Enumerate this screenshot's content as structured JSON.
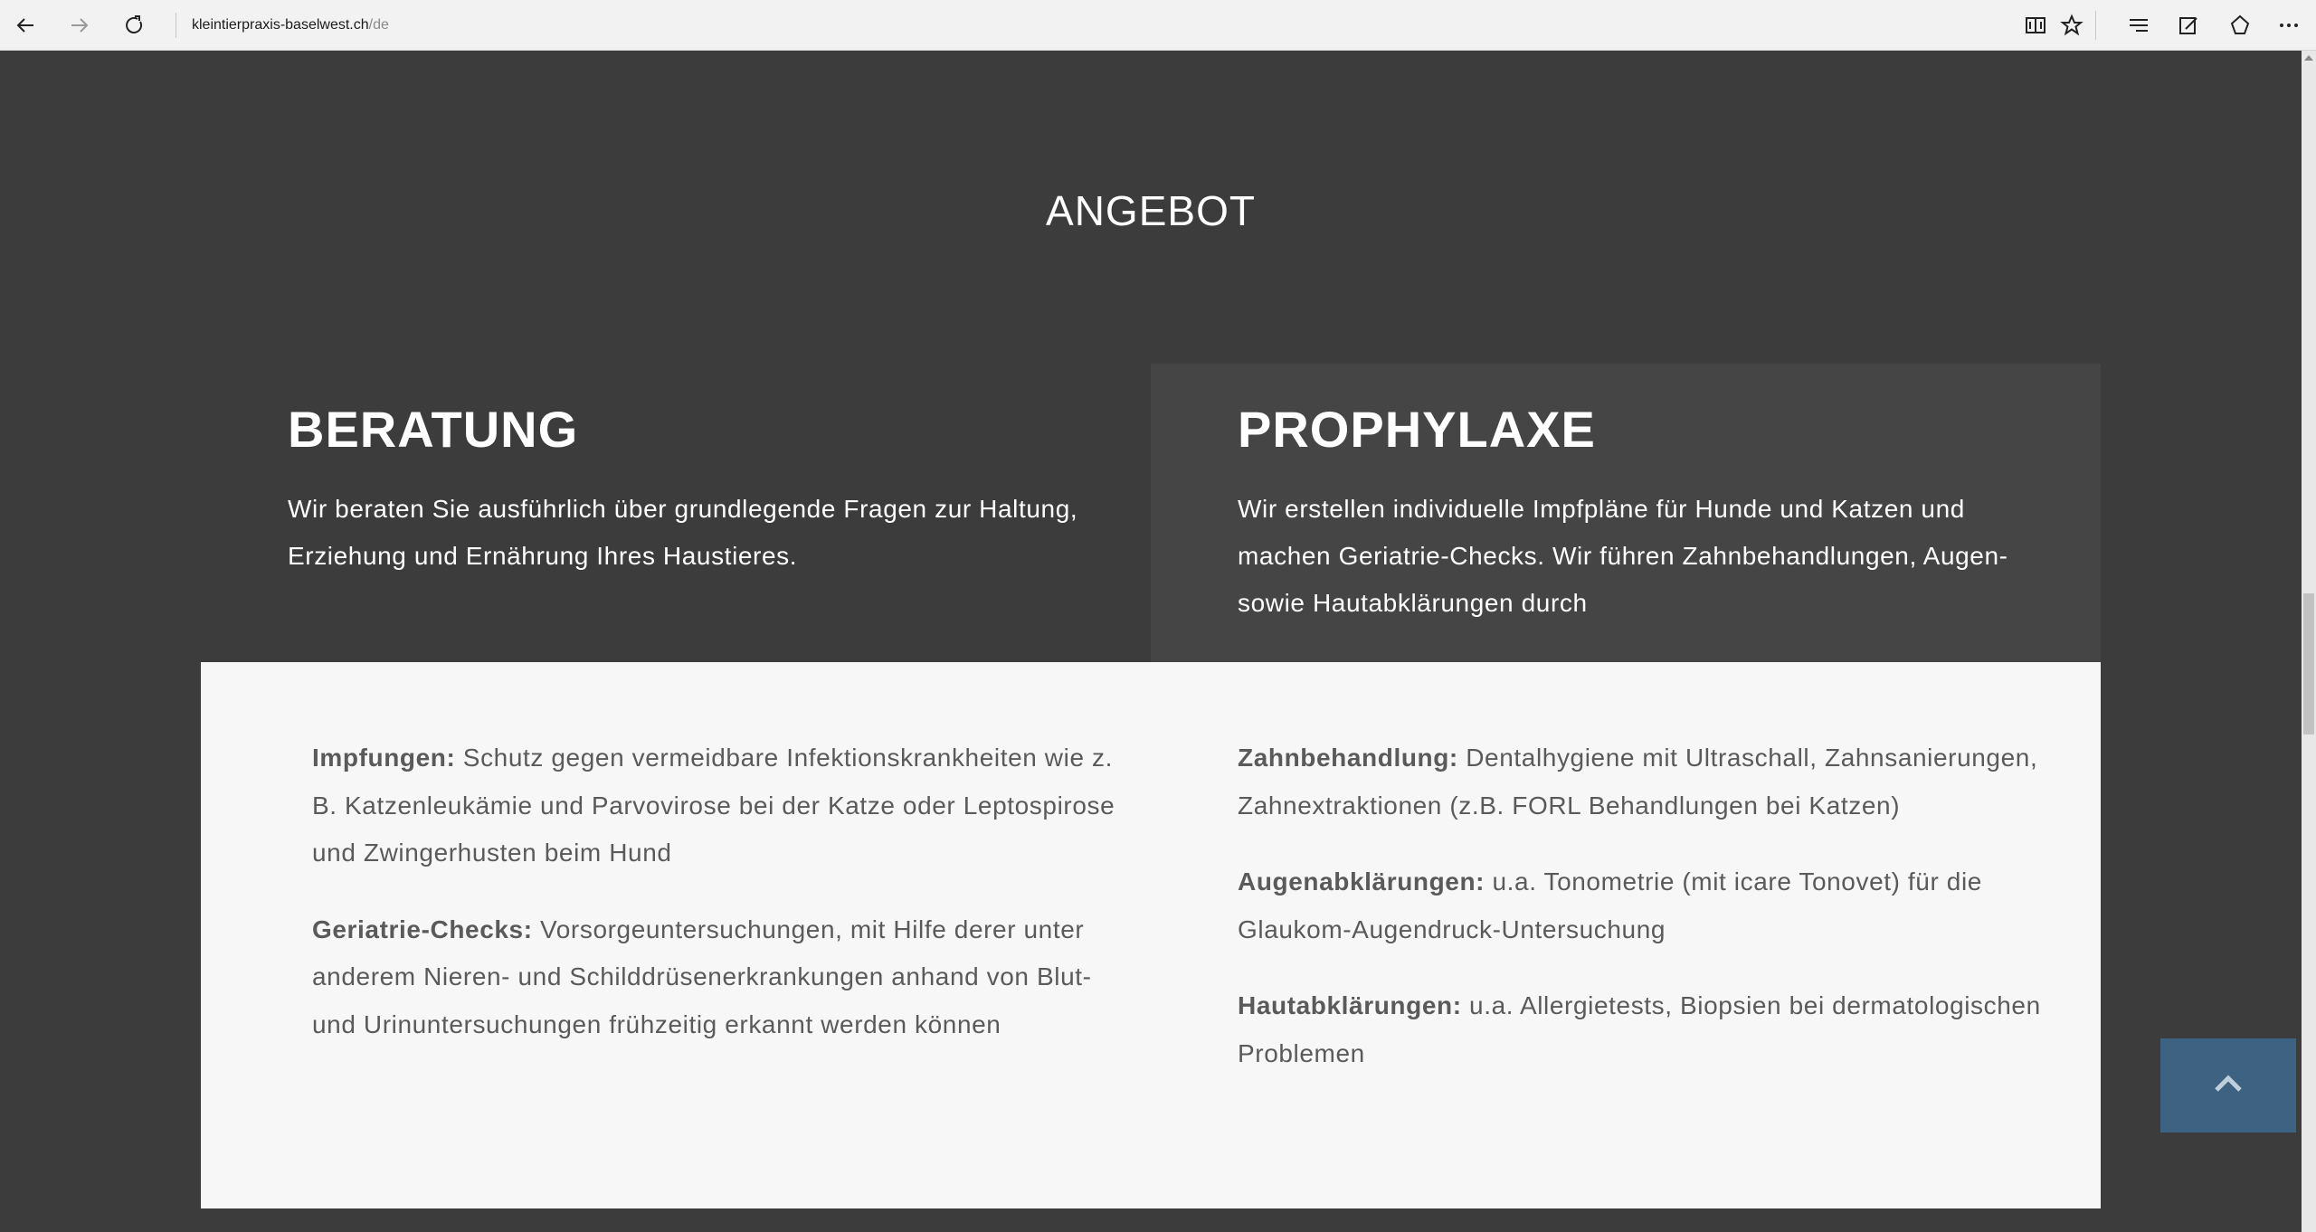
{
  "browser": {
    "url_domain": "kleintierpraxis-baselwest.ch",
    "url_path": "/de",
    "icons": [
      "back-icon",
      "forward-icon",
      "refresh-icon",
      "reading-view-icon",
      "favorite-star-icon",
      "hub-icon",
      "web-note-icon",
      "share-icon",
      "more-icon"
    ]
  },
  "section": {
    "title": "ANGEBOT"
  },
  "cards": [
    {
      "title": "BERATUNG",
      "text": "Wir beraten Sie ausführlich über grundlegende Fragen zur Haltung, Erziehung und Ernährung Ihres Haustieres."
    },
    {
      "title": "PROPHYLAXE",
      "text": "Wir erstellen individuelle Impfpläne für Hunde und Katzen und machen Geriatrie-Checks. Wir führen Zahnbehandlungen, Augen- sowie Hautabklärungen durch"
    }
  ],
  "details": {
    "left": [
      {
        "term": "Impfungen:",
        "desc": " Schutz gegen vermeidbare Infektionskrankheiten wie z. B. Katzenleukämie und Parvovirose bei der Katze oder Leptospirose und Zwingerhusten beim Hund"
      },
      {
        "term": "Geriatrie-Checks:",
        "desc": " Vorsorgeuntersuchungen, mit Hilfe derer unter anderem Nieren- und Schilddrüsenerkrankungen anhand von Blut- und Urinuntersuchungen frühzeitig erkannt werden können"
      }
    ],
    "right": [
      {
        "term": "Zahnbehandlung:",
        "desc": " Dentalhygiene mit Ultraschall, Zahnsanierungen, Zahnextraktionen (z.B. FORL Behandlungen bei Katzen)"
      },
      {
        "term": "Augenabklärungen:",
        "desc": " u.a. Tonometrie (mit icare Tonovet) für die Glaukom-Augendruck-Untersuchung"
      },
      {
        "term": "Hautabklärungen:",
        "desc": " u.a. Allergietests, Biopsien bei dermatologischen Problemen"
      }
    ]
  },
  "colors": {
    "page_bg": "#3c3c3c",
    "card_highlight": "#454545",
    "details_bg": "#f7f7f7",
    "to_top_button": "#3d6282"
  }
}
